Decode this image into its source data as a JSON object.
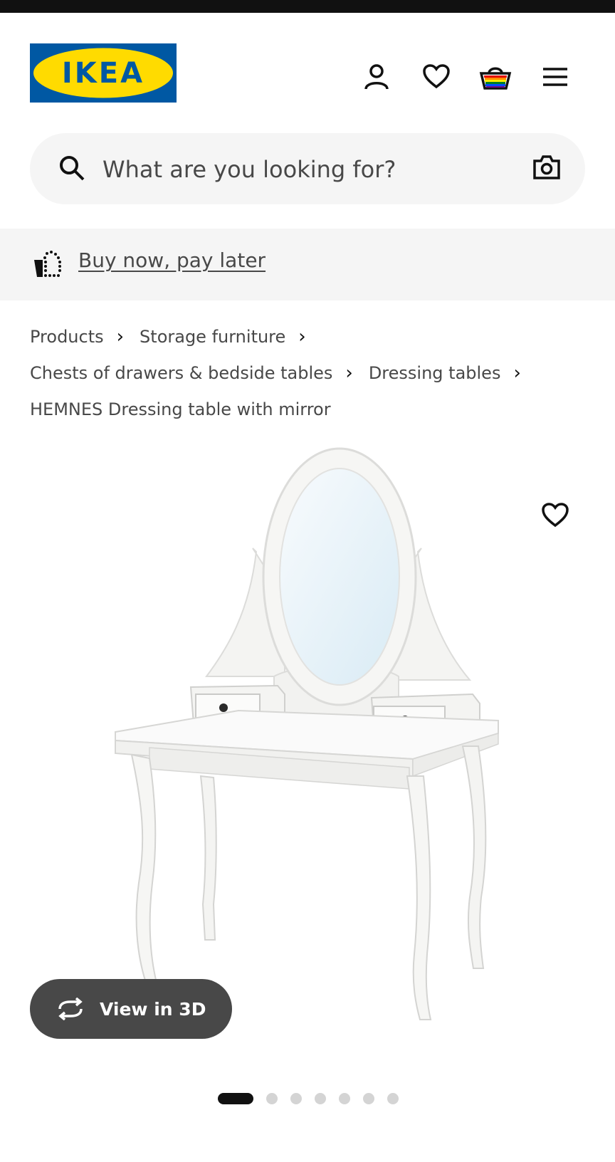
{
  "logo": {
    "text": "IKEA"
  },
  "header": {
    "icons": [
      "profile-icon",
      "heart-icon",
      "basket-icon",
      "menu-icon"
    ]
  },
  "search": {
    "placeholder": "What are you looking for?",
    "icons": [
      "search-icon",
      "camera-icon"
    ]
  },
  "promo": {
    "label": "Buy now, pay later",
    "icon": "installments-icon"
  },
  "breadcrumb": {
    "items": [
      "Products",
      "Storage furniture",
      "Chests of drawers & bedside tables",
      "Dressing tables",
      "HEMNES Dressing table with mirror"
    ]
  },
  "product": {
    "view3d_label": "View in 3D",
    "gallery_total": 7,
    "gallery_active": 1
  },
  "colors": {
    "brand_blue": "#0058a3",
    "brand_yellow": "#ffdb00",
    "dark_button": "#484848",
    "light_bg": "#f5f5f5"
  }
}
